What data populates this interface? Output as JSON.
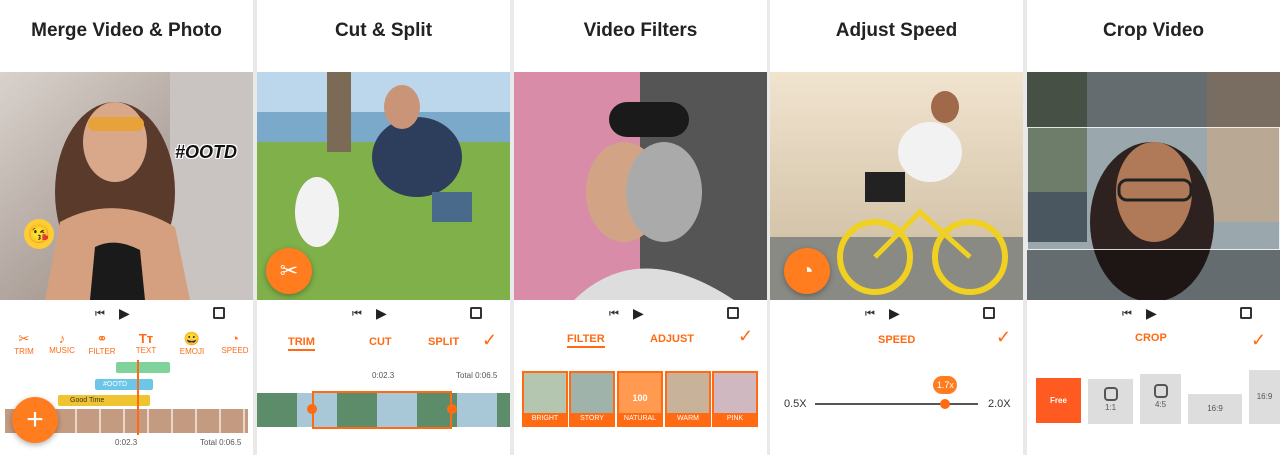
{
  "panels": [
    {
      "title": "Merge Video & Photo",
      "sticker_text": "#OOTD",
      "tools": [
        {
          "label": "TRIM",
          "icon": "scissors-icon"
        },
        {
          "label": "MUSIC",
          "icon": "music-icon"
        },
        {
          "label": "FILTER",
          "icon": "filter-icon"
        },
        {
          "label": "TEXT",
          "icon": "text-icon"
        },
        {
          "label": "EMOJI",
          "icon": "emoji-icon"
        },
        {
          "label": "SPEED",
          "icon": "speed-icon"
        }
      ],
      "tracks": [
        {
          "label": "#OOTD"
        },
        {
          "label": "Good Time"
        }
      ],
      "time_current": "0:02.3",
      "time_total": "Total 0:06.5",
      "add_button": "+"
    },
    {
      "title": "Cut & Split",
      "tabs": [
        "TRIM",
        "CUT",
        "SPLIT"
      ],
      "time_current": "0:02.3",
      "time_total": "Total 0:06.5"
    },
    {
      "title": "Video Filters",
      "tabs": [
        "FILTER",
        "ADJUST"
      ],
      "filters": [
        "BRIGHT",
        "STORY",
        "NATURAL",
        "WARM",
        "PINK"
      ],
      "filter_value": "100"
    },
    {
      "title": "Adjust Speed",
      "tab": "SPEED",
      "min_label": "0.5X",
      "max_label": "2.0X",
      "value_label": "1.7x",
      "value": 1.7
    },
    {
      "title": "Crop Video",
      "tab": "CROP",
      "ratios": [
        "Free",
        "1:1",
        "4:5",
        "16:9",
        "16:9"
      ]
    }
  ],
  "colors": {
    "accent": "#ff6a13"
  }
}
